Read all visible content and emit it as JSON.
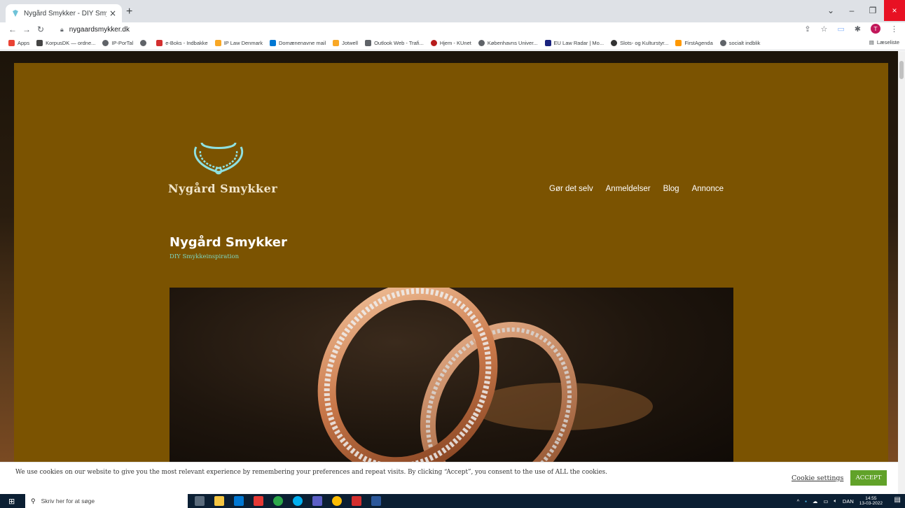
{
  "browser": {
    "tab_title": "Nygård Smykker - DIY Smykkeins",
    "new_tab": "+",
    "tab_close": "×",
    "url": "nygaardsmykker.dk",
    "profile_initial": "T",
    "window_controls": {
      "menu": "⌄",
      "minimize": "–",
      "restore": "❐",
      "close": "×"
    },
    "bookmarks": [
      {
        "label": "Apps",
        "color": "#ea4335"
      },
      {
        "label": "KorpusDK — ordne...",
        "color": "#444444"
      },
      {
        "label": "IP-PorTal",
        "color": "#5f6368"
      },
      {
        "label": "",
        "color": "#5f6368"
      },
      {
        "label": "e-Boks - Indbakke",
        "color": "#d32f2f"
      },
      {
        "label": "IP Law Denmark",
        "color": "#f9a825"
      },
      {
        "label": "Domænenavne mail",
        "color": "#0078d4"
      },
      {
        "label": "Jotwell",
        "color": "#f9a825"
      },
      {
        "label": "Outlook Web - Trafi...",
        "color": "#5f6368"
      },
      {
        "label": "Hjem - KUnet",
        "color": "#b71c1c"
      },
      {
        "label": "Københavns Univer...",
        "color": "#5f6368"
      },
      {
        "label": "EU Law Radar | Mo...",
        "color": "#1a237e"
      },
      {
        "label": "Slots- og Kulturstyr...",
        "color": "#333333"
      },
      {
        "label": "FirstAgenda",
        "color": "#ff9800"
      },
      {
        "label": "socialt indblik",
        "color": "#5f6368"
      }
    ],
    "reading_list": "Læseliste"
  },
  "site": {
    "logo_text": "Nygård Smykker",
    "nav": [
      "Gør det selv",
      "Anmeldelser",
      "Blog",
      "Annonce"
    ],
    "title": "Nygård Smykker",
    "tagline": "DIY Smykkeinspiration",
    "colors": {
      "background": "#7b5301",
      "tagline": "#7ed7c1",
      "logo_icon": "#8fe0e0"
    }
  },
  "cookie_bar": {
    "text": "We use cookies on our website to give you the most relevant experience by remembering your preferences and repeat visits. By clicking “Accept”, you consent to the use of ALL the cookies.",
    "settings_label": "Cookie settings",
    "accept_label": "ACCEPT",
    "accept_color": "#61a229"
  },
  "taskbar": {
    "search_placeholder": "Skriv her for at søge",
    "language": "DAN",
    "time": "14:55",
    "date": "13-03-2022"
  }
}
